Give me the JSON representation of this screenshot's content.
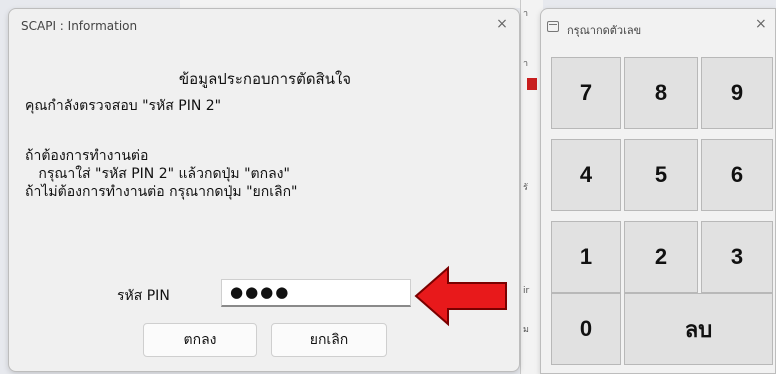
{
  "dialog": {
    "title": "SCAPI : Information",
    "close_glyph": "×",
    "heading": "ข้อมูลประกอบการตัดสินใจ",
    "lines": [
      "คุณกำลังตรวจสอบ \"รหัส PIN 2\"",
      "ถ้าต้องการทำงานต่อ",
      "   กรุณาใส่ \"รหัส PIN 2\" แล้วกดปุ่ม \"ตกลง\"",
      "ถ้าไม่ต้องการทำงานต่อ กรุณากดปุ่ม \"ยกเลิก\""
    ],
    "pin_label": "รหัส PIN",
    "pin_value": "●●●●",
    "ok_label": "ตกลง",
    "cancel_label": "ยกเลิก",
    "arrow_color": "#e8191b"
  },
  "keypad": {
    "title": "กรุณากดตัวเลข",
    "close_glyph": "×",
    "keys": [
      "7",
      "8",
      "9",
      "4",
      "5",
      "6",
      "1",
      "2",
      "3",
      "0",
      "ลบ"
    ]
  },
  "background": {
    "fragments": [
      "ำ",
      "า",
      "ร",
      "รั",
      "ir",
      "ม"
    ]
  }
}
